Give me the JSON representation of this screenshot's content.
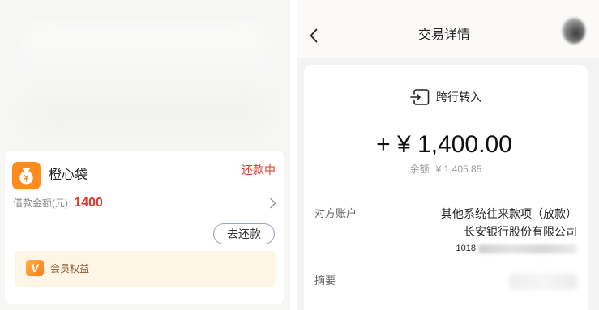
{
  "left_panel": {
    "loan": {
      "icon": "money-bag-icon",
      "product_name": "橙心袋",
      "status": "还款中",
      "amount_label": "借款金额(元):",
      "amount": "1400",
      "repay_button": "去还款"
    },
    "member_benefits": {
      "icon": "vip-badge-icon",
      "badge": "V",
      "label": "会员权益"
    }
  },
  "right_panel": {
    "header": {
      "back_icon": "chevron-left-icon",
      "title": "交易详情",
      "avatar": "user-avatar"
    },
    "transaction": {
      "type_icon": "transfer-in-icon",
      "type": "跨行转入",
      "amount": "+ ¥ 1,400.00",
      "balance_label": "余额",
      "balance": "¥ 1,405.85"
    },
    "counterparty": {
      "label": "对方账户",
      "account_name": "其他系统往来款项（放款）",
      "bank": "长安银行股份有限公司",
      "account_number_visible": "1018"
    },
    "summary": {
      "label": "摘要"
    }
  },
  "colors": {
    "accent_red": "#e2372c",
    "brand_orange": "#ff8a1e",
    "member_bg": "#fdf5e6",
    "member_text": "#8a5a2c"
  }
}
